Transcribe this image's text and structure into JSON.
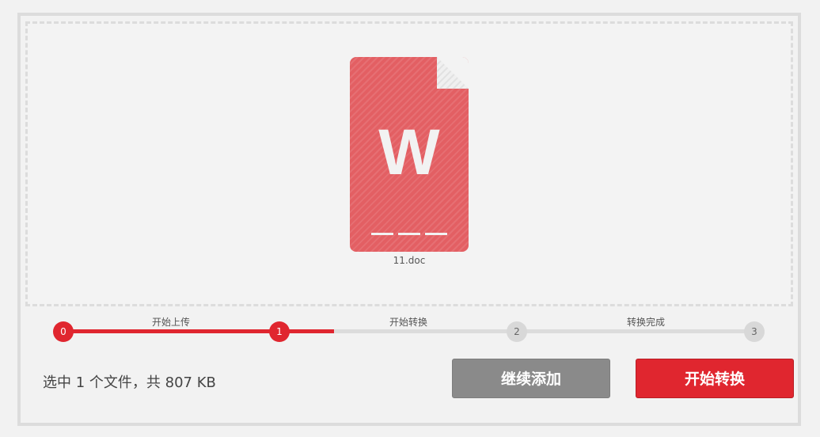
{
  "file": {
    "icon": "word-document-icon",
    "letter": "W",
    "name": "11.doc",
    "accent": "#e35f63"
  },
  "steps": [
    {
      "number": "0",
      "status": "done"
    },
    {
      "number": "1",
      "status": "done"
    },
    {
      "number": "2",
      "status": "todo"
    },
    {
      "number": "3",
      "status": "todo"
    }
  ],
  "step_labels": [
    "开始上传",
    "开始转换",
    "转换完成"
  ],
  "progress": 0.392,
  "summary": "选中 1 个文件，共 807 KB",
  "buttons": {
    "continue_label": "继续添加",
    "start_label": "开始转换"
  },
  "colors": {
    "primary": "#e0262f",
    "secondary": "#8a8a8a",
    "inactive": "#d8d8d8"
  }
}
